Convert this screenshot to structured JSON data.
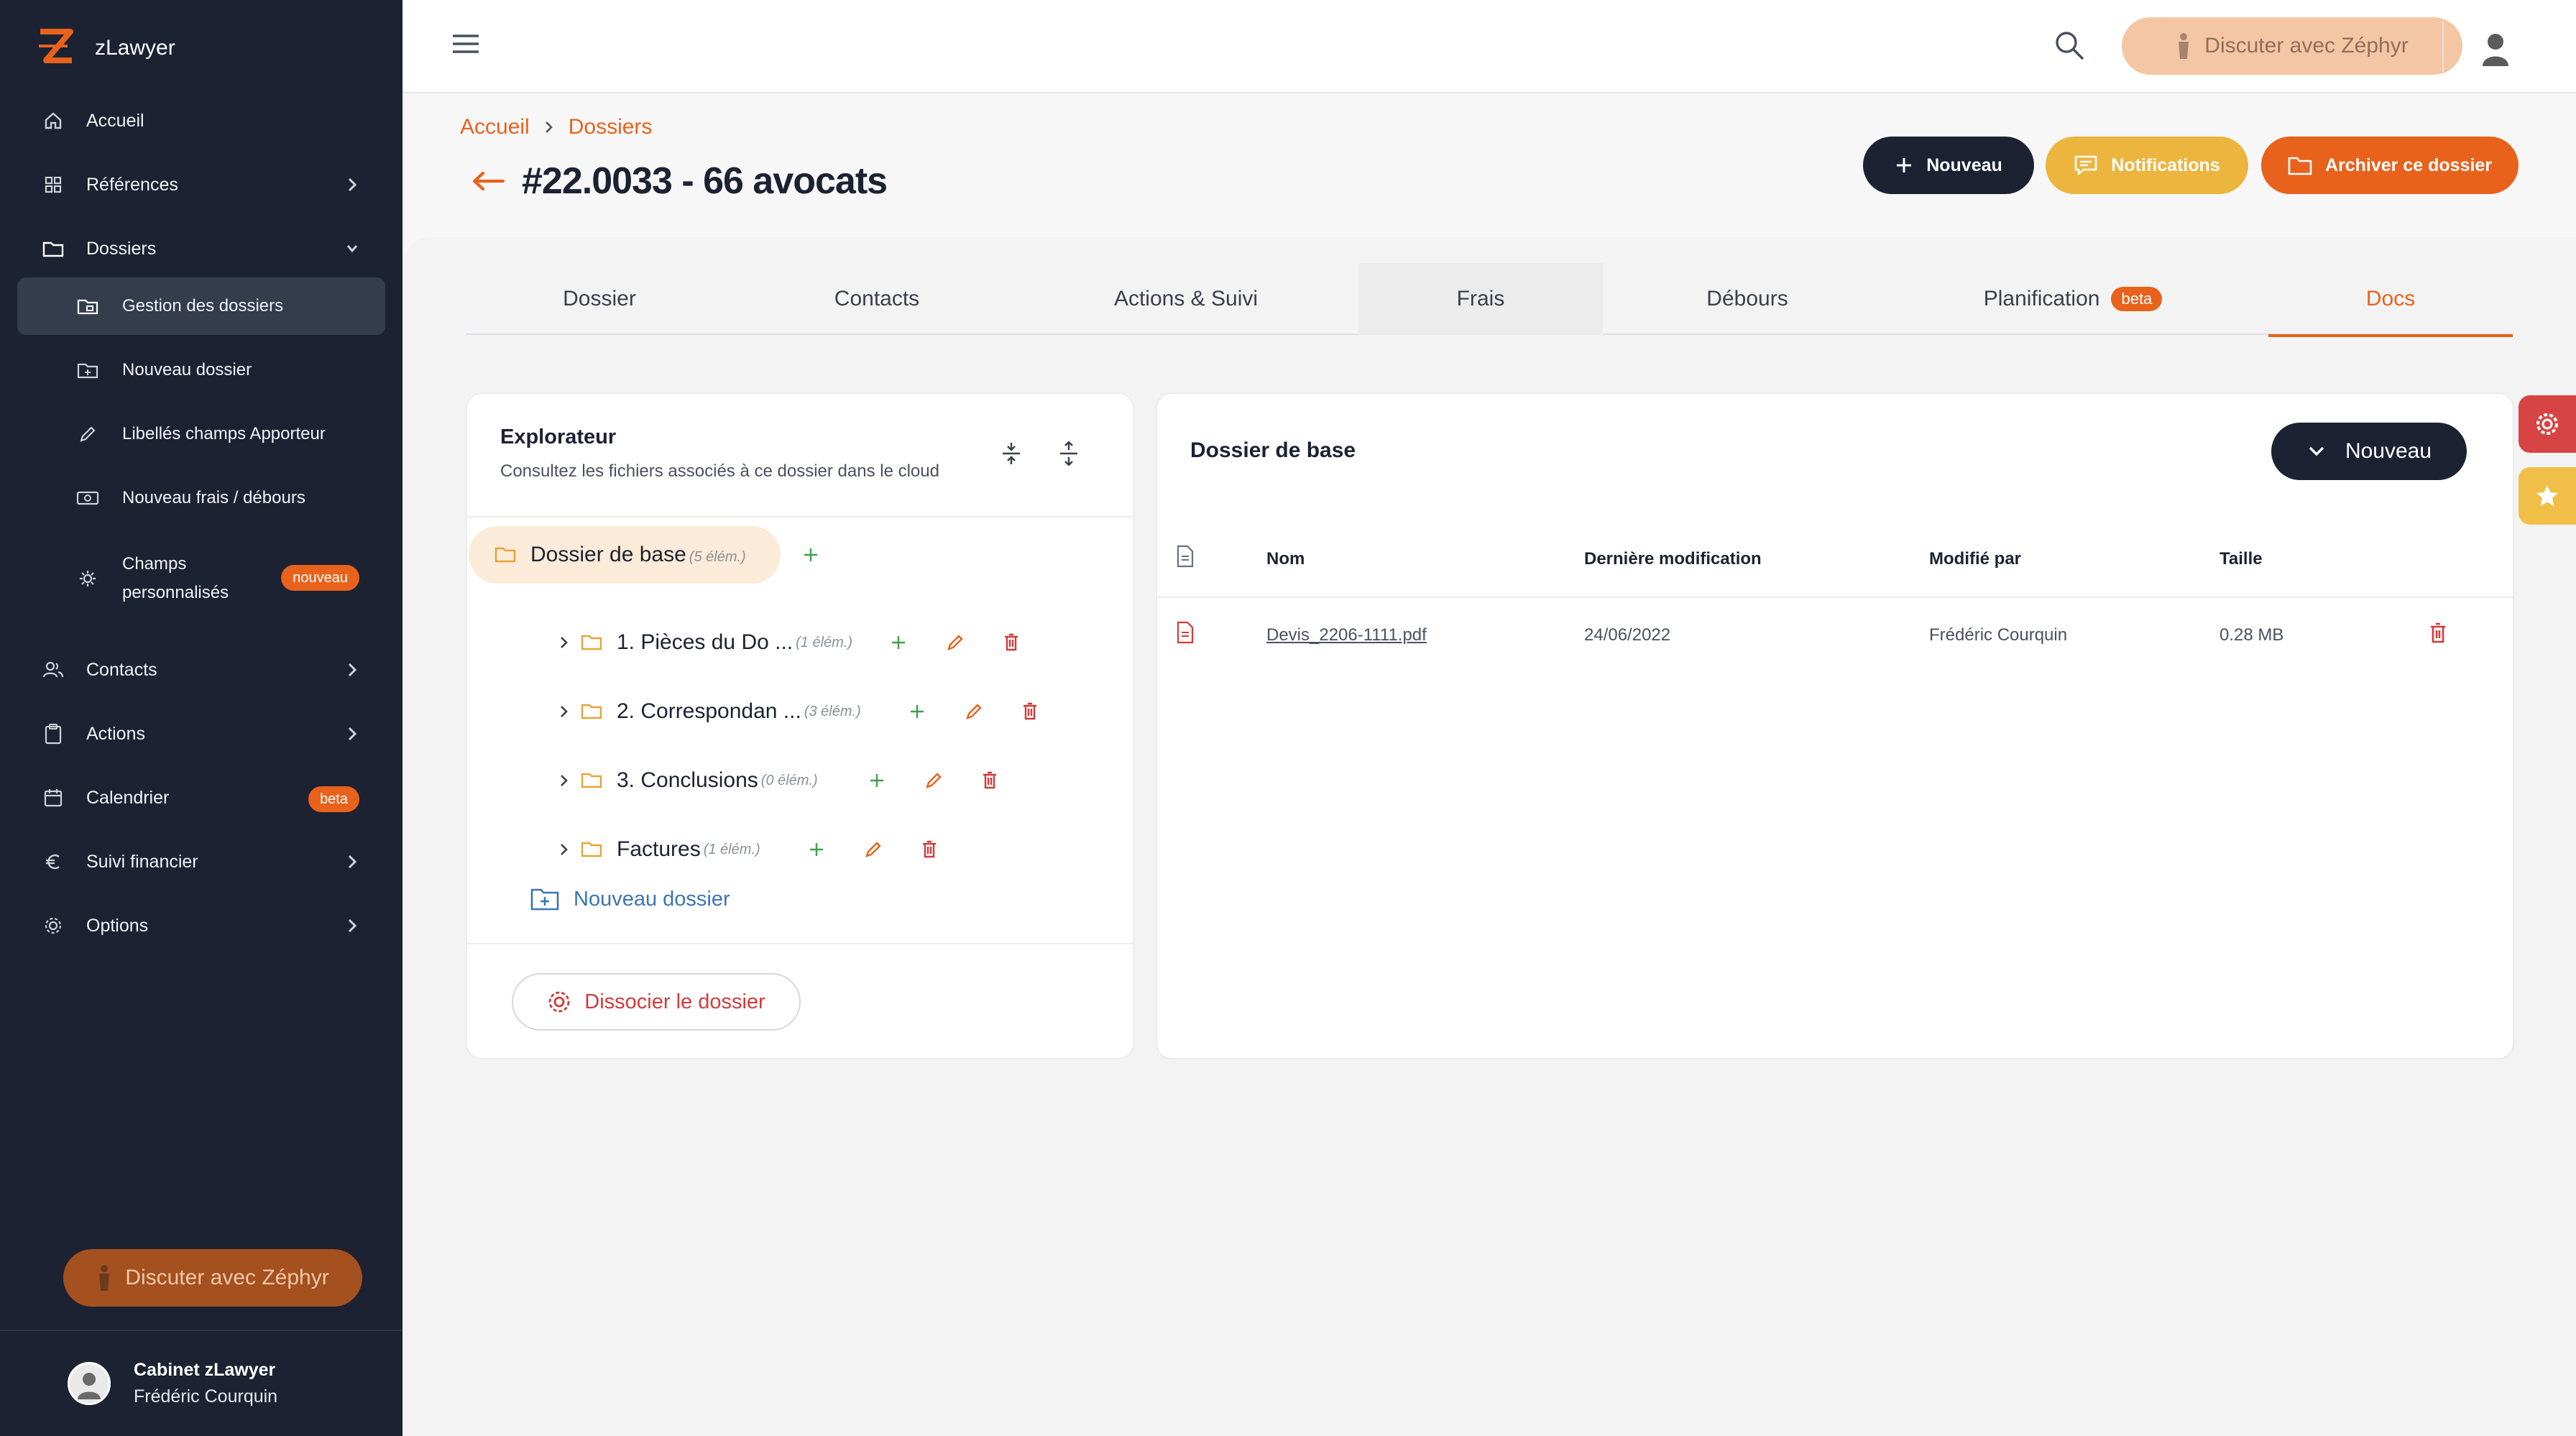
{
  "app": {
    "name": "zLawyer"
  },
  "colors": {
    "accent": "#e8621c",
    "sidebar_bg": "#1c2231",
    "notif": "#ecb53e",
    "danger": "#d33a3a"
  },
  "sidebar": {
    "items": [
      {
        "label": "Accueil",
        "icon": "home-icon"
      },
      {
        "label": "Références",
        "icon": "grid-icon"
      },
      {
        "label": "Dossiers",
        "icon": "folder-icon"
      },
      {
        "label": "Gestion des dossiers",
        "icon": "folder-manage-icon"
      },
      {
        "label": "Nouveau dossier",
        "icon": "folder-add-icon"
      },
      {
        "label": "Libellés champs Apporteur",
        "icon": "pencil-icon"
      },
      {
        "label": "Nouveau frais / débours",
        "icon": "cash-icon"
      },
      {
        "label_line1": "Champs",
        "label_line2": "personnalisés",
        "badge": "nouveau",
        "icon": "gears-icon"
      },
      {
        "label": "Contacts",
        "icon": "users-icon"
      },
      {
        "label": "Actions",
        "icon": "clipboard-icon"
      },
      {
        "label": "Calendrier",
        "badge": "beta",
        "icon": "calendar-icon"
      },
      {
        "label": "Suivi financier",
        "icon": "euro-icon"
      },
      {
        "label": "Options",
        "icon": "gear-icon"
      }
    ],
    "zephyr_button": "Discuter avec Zéphyr",
    "profile": {
      "org": "Cabinet zLawyer",
      "user": "Frédéric Courquin"
    }
  },
  "topbar": {
    "zephyr_button": "Discuter avec Zéphyr"
  },
  "breadcrumb": {
    "home": "Accueil",
    "current": "Dossiers"
  },
  "page": {
    "title": "#22.0033 - 66 avocats"
  },
  "actions": {
    "new": "Nouveau",
    "notifications": "Notifications",
    "archive": "Archiver ce dossier"
  },
  "tabs": [
    {
      "label": "Dossier"
    },
    {
      "label": "Contacts"
    },
    {
      "label": "Actions & Suivi"
    },
    {
      "label": "Frais"
    },
    {
      "label": "Débours"
    },
    {
      "label": "Planification",
      "badge": "beta"
    },
    {
      "label": "Docs"
    }
  ],
  "explorer": {
    "title": "Explorateur",
    "subtitle": "Consultez les fichiers associés à ce dossier dans le cloud",
    "root": {
      "name": "Dossier de base",
      "count": "(5 élém.)"
    },
    "folders": [
      {
        "name": "1. Pièces du Do ...",
        "count": "(1 élém.)"
      },
      {
        "name": "2. Correspondan ...",
        "count": "(3 élém.)"
      },
      {
        "name": "3. Conclusions",
        "count": "(0 élém.)"
      },
      {
        "name": "Factures",
        "count": "(1 élém.)"
      }
    ],
    "new_folder": "Nouveau dossier",
    "dissociate": "Dissocier le dossier"
  },
  "files": {
    "title": "Dossier de base",
    "new_button": "Nouveau",
    "columns": {
      "name": "Nom",
      "modified": "Dernière modification",
      "by": "Modifié par",
      "size": "Taille"
    },
    "rows": [
      {
        "name": "Devis_2206-1111.pdf",
        "modified": "24/06/2022",
        "by": "Frédéric Courquin",
        "size": "0.28 MB"
      }
    ]
  }
}
